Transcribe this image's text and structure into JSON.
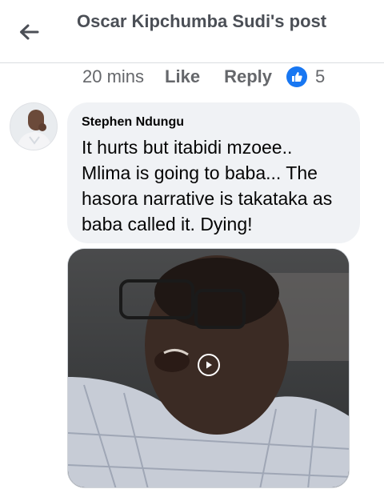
{
  "header": {
    "title": "Oscar Kipchumba Sudi's post",
    "back_icon": "arrow-left-icon"
  },
  "comment_meta": {
    "time": "20 mins",
    "like_label": "Like",
    "reply_label": "Reply",
    "reaction_icon": "thumbs-up-icon",
    "reaction_count": "5"
  },
  "comment": {
    "author": "Stephen Ndungu",
    "text": "It hurts but itabidi mzoee.. Mlima is going to baba... The hasora narrative is takataka as baba called it. Dying!"
  },
  "video": {
    "play_icon": "play-icon"
  },
  "colors": {
    "accent": "#1877f2",
    "bubble": "#f0f2f5",
    "muted_text": "#65676b"
  }
}
